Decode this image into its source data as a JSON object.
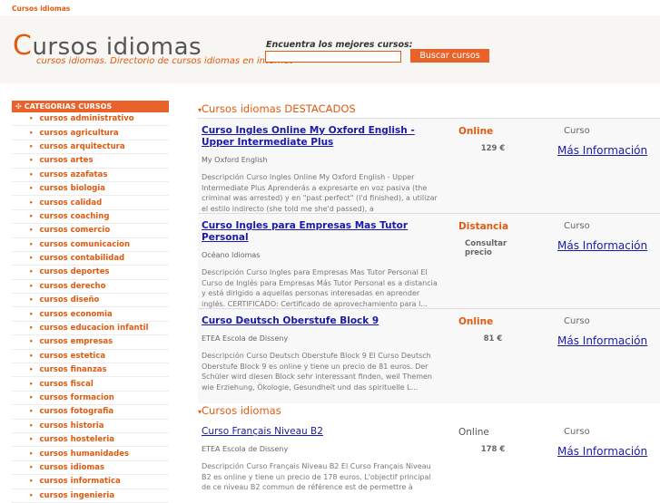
{
  "topbar": {
    "link": "Cursos idiomas"
  },
  "header": {
    "logo_cap": "C",
    "logo_rest": "ursos idiomas",
    "tagline": "cursos idiomas. Directorio de cursos idiomas en internet",
    "search_label": "Encuentra los mejores cursos:",
    "search_value": "",
    "search_button": "Buscar cursos"
  },
  "sidebar": {
    "heading": "CATEGORIAS CURSOS",
    "bullet": "•",
    "items": [
      "cursos administrativo",
      "cursos agricultura",
      "cursos arquitectura",
      "cursos artes",
      "cursos azafatas",
      "cursos biologia",
      "cursos calidad",
      "cursos coaching",
      "cursos comercio",
      "cursos comunicacion",
      "cursos contabilidad",
      "cursos deportes",
      "cursos derecho",
      "cursos diseño",
      "cursos economia",
      "cursos educacion infantil",
      "cursos empresas",
      "cursos estetica",
      "cursos finanzas",
      "cursos fiscal",
      "cursos formacion",
      "cursos fotografia",
      "cursos historia",
      "cursos hosteleria",
      "cursos humanidades",
      "cursos idiomas",
      "cursos informatica",
      "cursos ingenieria"
    ]
  },
  "sections": {
    "featured": "Cursos idiomas DESTACADOS",
    "regular": "Cursos idiomas",
    "arrow": "▾"
  },
  "listings": [
    {
      "title": "Curso Ingles Online My Oxford English - Upper Intermediate Plus",
      "provider": "My Oxford English",
      "mode": "Online",
      "price": "129 €",
      "type": "Curso",
      "more": "Más Información",
      "desc": "Descripción Curso Ingles Online My Oxford English - Upper Intermediate Plus Aprenderás a expresarte en voz pasiva (the criminal was arrested) y en \"past perfect\" (I'd finished), a utilizar el estilo indirecto (she told me she'd passed), a"
    },
    {
      "title": "Curso Ingles para Empresas Mas Tutor Personal",
      "provider": "Océano Idiomas",
      "mode": "Distancia",
      "price": "Consultar precio",
      "type": "Curso",
      "more": "Más Información",
      "desc": "Descripción Curso Ingles para Empresas Mas Tutor Personal El Curso de Inglés para Empresas Más Tutor Personal es a distancia y está dirigido a aquellas personas interesadas en aprender inglés. CERTIFICADO: Certificado de aprovechamiento para l..."
    },
    {
      "title": "Curso Deutsch Oberstufe Block 9",
      "provider": "ETEA Escola de Disseny",
      "mode": "Online",
      "price": "81 €",
      "type": "Curso",
      "more": "Más Información",
      "desc": "Descripción Curso Deutsch Oberstufe Block 9 El Curso Deutsch Oberstufe Block 9 es online y tiene un precio de 81 euros. Der Schüler wird diesen Block sehr interessant finden, weil Themen wie Erziehung, Ökologie, Gesundheit und das spirituelle L..."
    },
    {
      "title": "Curso Français Niveau B2",
      "provider": "ETEA Escola de Disseny",
      "mode": "Online",
      "price": "178 €",
      "type": "Curso",
      "more": "Más Información",
      "desc": "Descripción Curso Français Niveau B2 El Curso Français Niveau B2 es online y tiene un precio de 178 euros. L'objectif principal de ce niveau B2 commun de référence est de permettre à"
    }
  ]
}
